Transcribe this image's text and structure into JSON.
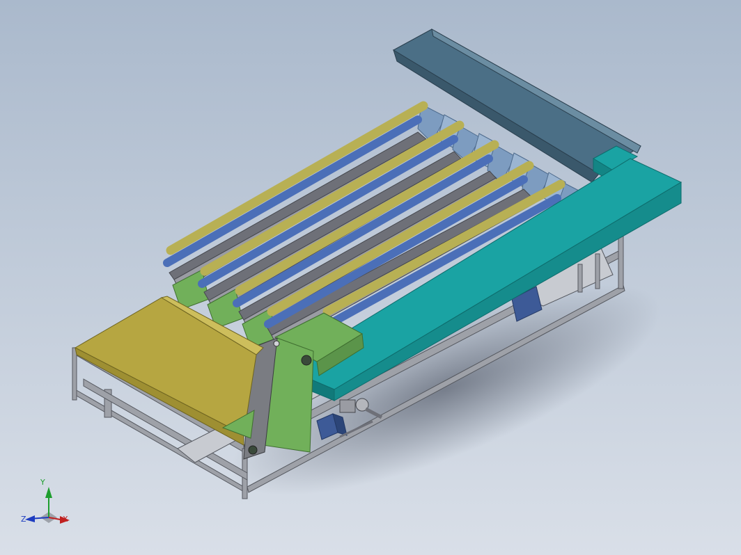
{
  "viewport": {
    "background_top": "#aab9cc",
    "background_bottom": "#d9dfe8"
  },
  "model": {
    "colors": {
      "hopper": "#4b6f86",
      "chutes": "#7d9cc0",
      "side_beam": "#1aa3a3",
      "rod_yellow": "#b8b054",
      "rod_blue": "#4b6fb8",
      "conveyor_belt": "#71b05a",
      "collection_tray": "#b6a641",
      "frame": "#8d9099",
      "motor": "#3d5a97"
    },
    "roller_rows": 5
  },
  "axis_triad": {
    "y_label": "Y",
    "z_label": "Z",
    "x_label": "X",
    "y_color": "#1e9e2e",
    "z_color": "#1e3cc0",
    "x_color": "#c02020"
  }
}
